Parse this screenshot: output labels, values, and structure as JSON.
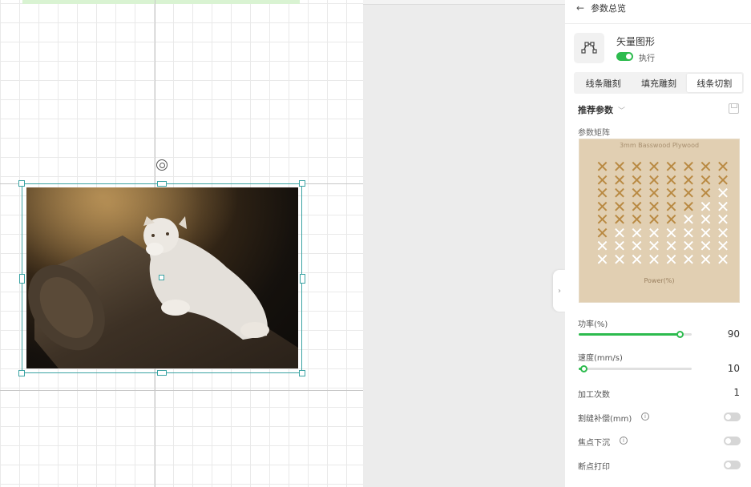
{
  "panel": {
    "back_icon": "arrow-left-icon",
    "title": "参数总览",
    "layer": {
      "icon": "vector-path-icon",
      "name": "矢量图形",
      "execute_label": "执行",
      "execute_on": true
    },
    "tabs": [
      {
        "label": "线条雕刻",
        "active": false
      },
      {
        "label": "填充雕刻",
        "active": false
      },
      {
        "label": "线条切割",
        "active": true
      }
    ],
    "recommended_label": "推荐参数",
    "matrix_label": "参数矩阵",
    "matrix_image": {
      "title": "3mm Basswood Plywood",
      "footer": "Power(%)"
    },
    "power": {
      "label": "功率",
      "unit": "(%)",
      "value": "90",
      "level": 0.9
    },
    "speed": {
      "label": "速度",
      "unit": "(mm/s)",
      "value": "10",
      "level": 0.05
    },
    "passes": {
      "label": "加工次数",
      "value": "1"
    },
    "kerf": {
      "label": "割缝补偿",
      "unit": "(mm)",
      "enabled": false
    },
    "focus": {
      "label": "焦点下沉",
      "enabled": false
    },
    "breakpoint": {
      "label": "断点打印",
      "enabled": false
    }
  },
  "colors": {
    "accent": "#2dbb4e",
    "selection": "#3aa3a3"
  }
}
